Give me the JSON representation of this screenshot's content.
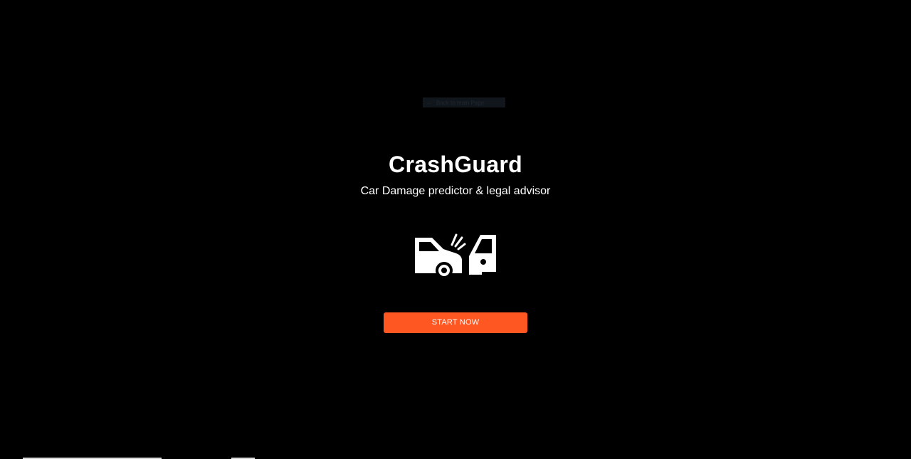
{
  "app": {
    "title": "CrashGuard",
    "subtitle": "Car Damage predictor & legal advisor"
  },
  "nav": {
    "back_label": "Back to main Page",
    "back_icon": "arrow-left-icon"
  },
  "hero": {
    "icon": "car-crash-icon"
  },
  "cta": {
    "start_label": "START NOW"
  },
  "colors": {
    "background": "#000000",
    "accent": "#fe5722",
    "text": "#ffffff"
  }
}
